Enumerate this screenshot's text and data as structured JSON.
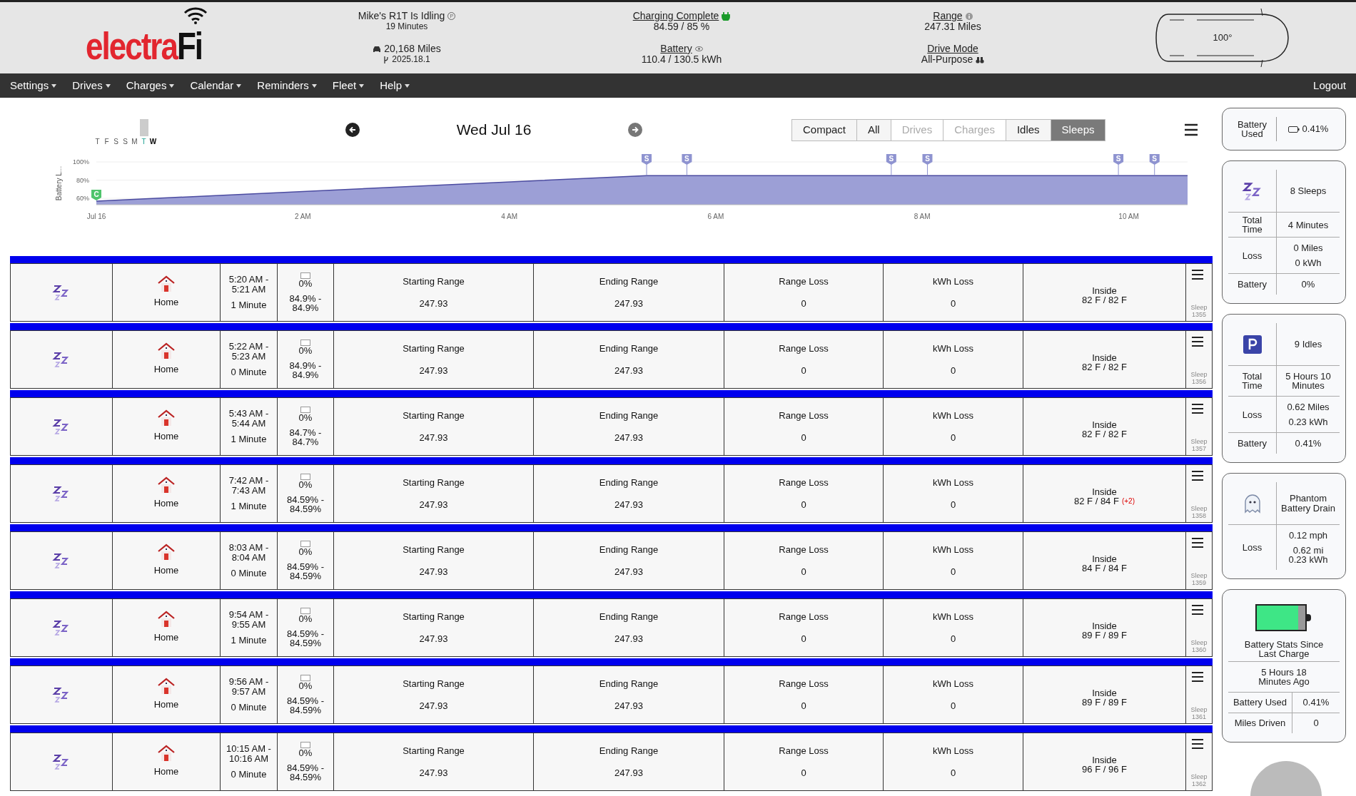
{
  "header": {
    "logo": {
      "left": "electra",
      "right": "Fi"
    },
    "status": {
      "title": "Mike's R1T Is Idling",
      "badge": "P",
      "duration": "19 Minutes",
      "odometer": "20,168 Miles",
      "version": "2025.18.1"
    },
    "charging": {
      "title": "Charging Complete",
      "value": "84.59 / 85 %"
    },
    "battery": {
      "title": "Battery",
      "value": "110.4 / 130.5 kWh"
    },
    "range": {
      "title": "Range",
      "value": "247.31 Miles"
    },
    "drive_mode": {
      "title": "Drive Mode",
      "value": "All-Purpose"
    },
    "temperature": "100°"
  },
  "nav": {
    "items": [
      "Settings",
      "Drives",
      "Charges",
      "Calendar",
      "Reminders",
      "Fleet",
      "Help"
    ],
    "logout": "Logout"
  },
  "week": [
    {
      "label": "T",
      "selected": false,
      "current": false
    },
    {
      "label": "F",
      "selected": false,
      "current": false
    },
    {
      "label": "S",
      "selected": false,
      "current": false
    },
    {
      "label": "S",
      "selected": false,
      "current": false
    },
    {
      "label": "M",
      "selected": false,
      "current": false
    },
    {
      "label": "T",
      "selected": true,
      "current": false
    },
    {
      "label": "W",
      "selected": false,
      "current": true
    }
  ],
  "date": "Wed Jul 16",
  "filters": [
    {
      "label": "Compact",
      "selected": false,
      "disabled": false
    },
    {
      "label": "All",
      "selected": false,
      "disabled": false
    },
    {
      "label": "Drives",
      "selected": false,
      "disabled": true
    },
    {
      "label": "Charges",
      "selected": false,
      "disabled": true
    },
    {
      "label": "Idles",
      "selected": false,
      "disabled": false
    },
    {
      "label": "Sleeps",
      "selected": true,
      "disabled": false
    }
  ],
  "chart_data": {
    "type": "area",
    "ylabel": "Battery L...",
    "x": [
      0,
      5.33,
      10.57
    ],
    "series": [
      {
        "color": "#9c9fd6",
        "values": [
          57,
          85,
          85
        ]
      }
    ],
    "xlim": [
      0,
      10.57
    ],
    "ylim": [
      53,
      100
    ],
    "xticks": [
      {
        "value": 0,
        "label": "Jul 16"
      },
      {
        "value": 2,
        "label": "2 AM"
      },
      {
        "value": 4,
        "label": "4 AM"
      },
      {
        "value": 6,
        "label": "6 AM"
      },
      {
        "value": 8,
        "label": "8 AM"
      },
      {
        "value": 10,
        "label": "10 AM"
      }
    ],
    "yticks": [
      {
        "value": 60,
        "label": "60%"
      },
      {
        "value": 80,
        "label": "80%"
      },
      {
        "value": 100,
        "label": "100%"
      }
    ],
    "annotations": [
      {
        "x": 0,
        "y": 57,
        "text": "C"
      },
      {
        "x": 5.33,
        "y": 85,
        "text": "S"
      },
      {
        "x": 5.72,
        "y": 85,
        "text": "S"
      },
      {
        "x": 7.7,
        "y": 85,
        "text": "S"
      },
      {
        "x": 8.05,
        "y": 85,
        "text": "S"
      },
      {
        "x": 9.9,
        "y": 85,
        "text": "S"
      },
      {
        "x": 10.25,
        "y": 85,
        "text": "S"
      }
    ]
  },
  "rows": [
    {
      "place": "Home",
      "time_start": "5:20 AM -",
      "time_end": "5:21 AM",
      "duration": "1 Minute",
      "battery_used": "0%",
      "battery_start": "84.9% -",
      "battery_end": "84.9%",
      "cells": [
        {
          "label": "Starting Range",
          "value": "247.93"
        },
        {
          "label": "Ending Range",
          "value": "247.93"
        },
        {
          "label": "Range Loss",
          "value": "0"
        },
        {
          "label": "kWh Loss",
          "value": "0"
        }
      ],
      "inside_label": "Inside",
      "inside": "82 F / 82 F",
      "id": "Sleep 1355"
    },
    {
      "place": "Home",
      "time_start": "5:22 AM -",
      "time_end": "5:23 AM",
      "duration": "0 Minute",
      "battery_used": "0%",
      "battery_start": "84.9% -",
      "battery_end": "84.9%",
      "cells": [
        {
          "label": "Starting Range",
          "value": "247.93"
        },
        {
          "label": "Ending Range",
          "value": "247.93"
        },
        {
          "label": "Range Loss",
          "value": "0"
        },
        {
          "label": "kWh Loss",
          "value": "0"
        }
      ],
      "inside_label": "Inside",
      "inside": "82 F / 82 F",
      "id": "Sleep 1356"
    },
    {
      "place": "Home",
      "time_start": "5:43 AM -",
      "time_end": "5:44 AM",
      "duration": "1 Minute",
      "battery_used": "0%",
      "battery_start": "84.7% -",
      "battery_end": "84.7%",
      "cells": [
        {
          "label": "Starting Range",
          "value": "247.93"
        },
        {
          "label": "Ending Range",
          "value": "247.93"
        },
        {
          "label": "Range Loss",
          "value": "0"
        },
        {
          "label": "kWh Loss",
          "value": "0"
        }
      ],
      "inside_label": "Inside",
      "inside": "82 F / 82 F",
      "id": "Sleep 1357"
    },
    {
      "place": "Home",
      "time_start": "7:42 AM -",
      "time_end": "7:43 AM",
      "duration": "1 Minute",
      "battery_used": "0%",
      "battery_start": "84.59% -",
      "battery_end": "84.59%",
      "cells": [
        {
          "label": "Starting Range",
          "value": "247.93"
        },
        {
          "label": "Ending Range",
          "value": "247.93"
        },
        {
          "label": "Range Loss",
          "value": "0"
        },
        {
          "label": "kWh Loss",
          "value": "0"
        }
      ],
      "inside_label": "Inside",
      "inside": "82 F / 84 F",
      "delta": "(+2)",
      "id": "Sleep 1358"
    },
    {
      "place": "Home",
      "time_start": "8:03 AM -",
      "time_end": "8:04 AM",
      "duration": "0 Minute",
      "battery_used": "0%",
      "battery_start": "84.59% -",
      "battery_end": "84.59%",
      "cells": [
        {
          "label": "Starting Range",
          "value": "247.93"
        },
        {
          "label": "Ending Range",
          "value": "247.93"
        },
        {
          "label": "Range Loss",
          "value": "0"
        },
        {
          "label": "kWh Loss",
          "value": "0"
        }
      ],
      "inside_label": "Inside",
      "inside": "84 F / 84 F",
      "id": "Sleep 1359"
    },
    {
      "place": "Home",
      "time_start": "9:54 AM -",
      "time_end": "9:55 AM",
      "duration": "1 Minute",
      "battery_used": "0%",
      "battery_start": "84.59% -",
      "battery_end": "84.59%",
      "cells": [
        {
          "label": "Starting Range",
          "value": "247.93"
        },
        {
          "label": "Ending Range",
          "value": "247.93"
        },
        {
          "label": "Range Loss",
          "value": "0"
        },
        {
          "label": "kWh Loss",
          "value": "0"
        }
      ],
      "inside_label": "Inside",
      "inside": "89 F / 89 F",
      "id": "Sleep 1360"
    },
    {
      "place": "Home",
      "time_start": "9:56 AM -",
      "time_end": "9:57 AM",
      "duration": "0 Minute",
      "battery_used": "0%",
      "battery_start": "84.59% -",
      "battery_end": "84.59%",
      "cells": [
        {
          "label": "Starting Range",
          "value": "247.93"
        },
        {
          "label": "Ending Range",
          "value": "247.93"
        },
        {
          "label": "Range Loss",
          "value": "0"
        },
        {
          "label": "kWh Loss",
          "value": "0"
        }
      ],
      "inside_label": "Inside",
      "inside": "89 F / 89 F",
      "id": "Sleep 1361"
    },
    {
      "place": "Home",
      "time_start": "10:15 AM -",
      "time_end": "10:16 AM",
      "duration": "0 Minute",
      "battery_used": "0%",
      "battery_start": "84.59% -",
      "battery_end": "84.59%",
      "cells": [
        {
          "label": "Starting Range",
          "value": "247.93"
        },
        {
          "label": "Ending Range",
          "value": "247.93"
        },
        {
          "label": "Range Loss",
          "value": "0"
        },
        {
          "label": "kWh Loss",
          "value": "0"
        }
      ],
      "inside_label": "Inside",
      "inside": "96 F / 96 F",
      "id": "Sleep 1362"
    }
  ],
  "cards": [
    {
      "kind": "single",
      "label": "Battery Used",
      "value": "0.41%"
    },
    {
      "kind": "sleeps",
      "title": "8 Sleeps",
      "rows": [
        {
          "label": "Total Time",
          "values": [
            "4 Minutes"
          ]
        },
        {
          "label": "Loss",
          "values": [
            "0 Miles",
            "0 kWh"
          ]
        },
        {
          "label": "Battery",
          "values": [
            "0%"
          ]
        }
      ]
    },
    {
      "kind": "idles",
      "title": "9 Idles",
      "rows": [
        {
          "label": "Total Time",
          "values": [
            "5 Hours 10 Minutes"
          ]
        },
        {
          "label": "Loss",
          "values": [
            "0.62 Miles",
            "0.23 kWh"
          ]
        },
        {
          "label": "Battery",
          "values": [
            "0.41%"
          ]
        }
      ]
    },
    {
      "kind": "phantom",
      "title": "Phantom Battery Drain",
      "rows": [
        {
          "label": "Loss",
          "values": [
            "0.12 mph",
            "0.62 mi 0.23 kWh"
          ]
        }
      ]
    },
    {
      "kind": "battery",
      "level": 0.85,
      "title": "Battery Stats Since Last Charge",
      "since": "5 Hours 18 Minutes Ago",
      "rows": [
        {
          "label": "Battery Used",
          "value": "0.41%"
        },
        {
          "label": "Miles Driven",
          "value": "0"
        }
      ]
    }
  ]
}
